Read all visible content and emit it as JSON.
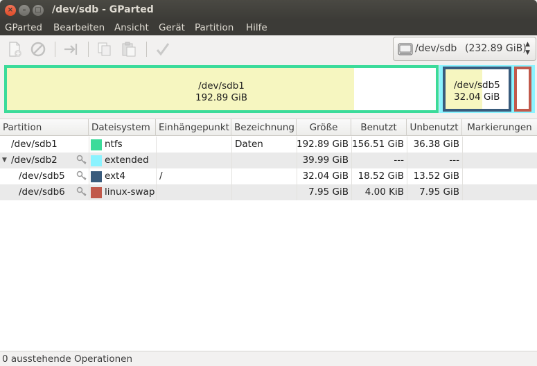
{
  "window": {
    "title": "/dev/sdb - GParted"
  },
  "menu": [
    "GParted",
    "Bearbeiten",
    "Ansicht",
    "Gerät",
    "Partition",
    "Hilfe"
  ],
  "toolbar": {
    "icons": [
      "new-partition-icon",
      "delete-icon",
      "resize-move-icon",
      "copy-icon",
      "paste-icon",
      "apply-icon"
    ],
    "device": {
      "name": "/dev/sdb",
      "size": "(232.89 GiB)"
    }
  },
  "graph": {
    "sdb1": {
      "name": "/dev/sdb1",
      "size": "192.89 GiB",
      "used_fraction": 0.81
    },
    "sdb5": {
      "name": "/dev/sdb5",
      "size": "32.04 GiB",
      "used_fraction": 0.58
    }
  },
  "table": {
    "columns": [
      "Partition",
      "Dateisystem",
      "Einhängepunkt",
      "Bezeichnung",
      "Größe",
      "Benutzt",
      "Unbenutzt",
      "Markierungen"
    ],
    "rows": [
      {
        "partition": "/dev/sdb1",
        "filesystem": "ntfs",
        "fs_color": "#3bdb9a",
        "mount": "",
        "label": "Daten",
        "size": "192.89 GiB",
        "used": "156.51 GiB",
        "unused": "36.38 GiB",
        "flags": ""
      },
      {
        "partition": "/dev/sdb2",
        "filesystem": "extended",
        "fs_color": "#8bf3ff",
        "mount": "",
        "label": "",
        "size": "39.99 GiB",
        "used": "---",
        "unused": "---",
        "flags": ""
      },
      {
        "partition": "/dev/sdb5",
        "filesystem": "ext4",
        "fs_color": "#395b7c",
        "mount": "/",
        "label": "",
        "size": "32.04 GiB",
        "used": "18.52 GiB",
        "unused": "13.52 GiB",
        "flags": ""
      },
      {
        "partition": "/dev/sdb6",
        "filesystem": "linux-swap",
        "fs_color": "#c1594b",
        "mount": "",
        "label": "",
        "size": "7.95 GiB",
        "used": "4.00 KiB",
        "unused": "7.95 GiB",
        "flags": ""
      }
    ]
  },
  "status": {
    "text": "0 ausstehende Operationen"
  }
}
